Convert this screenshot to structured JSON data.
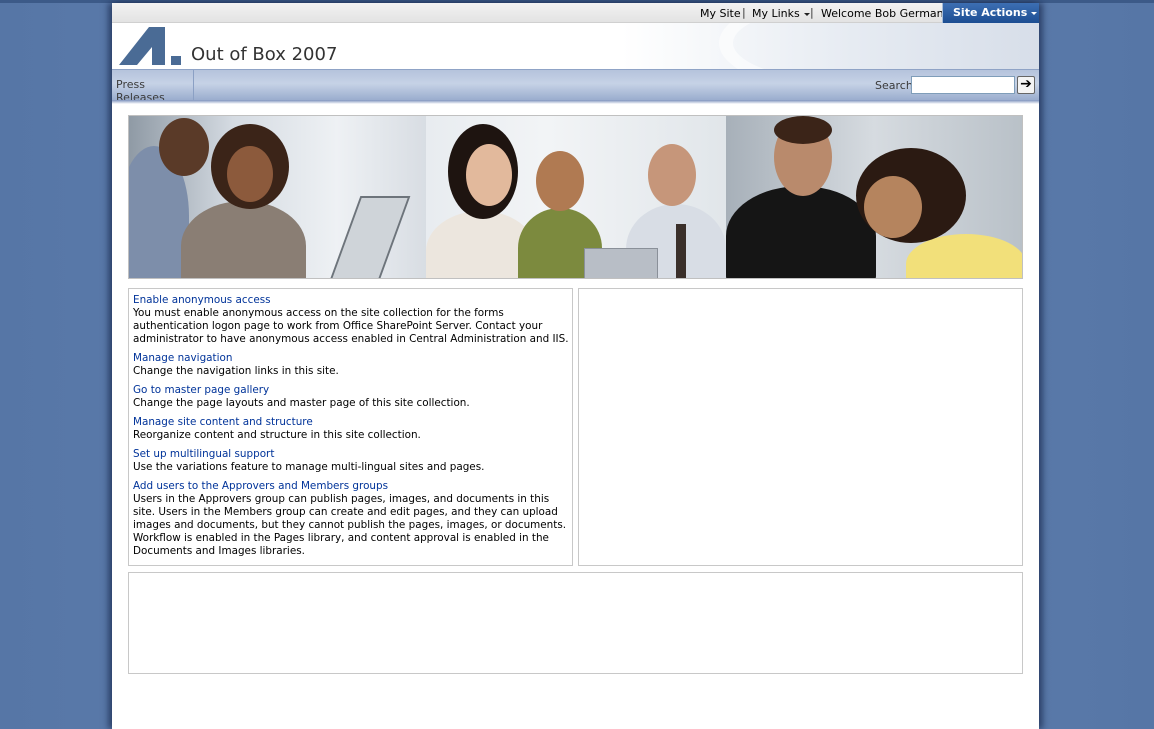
{
  "global_nav": {
    "my_site": "My Site",
    "separator": "|",
    "my_links": "My Links",
    "welcome": "Welcome Bob German",
    "site_actions": "Site Actions"
  },
  "header": {
    "site_title": "Out of Box 2007"
  },
  "top_nav": {
    "items": [
      {
        "label": "Press Releases"
      }
    ],
    "search_label": "Search",
    "search_value": "",
    "search_go_icon": "arrow-right-icon"
  },
  "tasks": [
    {
      "title": "Enable anonymous access",
      "description": "You must enable anonymous access on the site collection for the forms authentication logon page to work from Office SharePoint Server. Contact your administrator to have anonymous access enabled in Central Administration and IIS."
    },
    {
      "title": "Manage navigation",
      "description": "Change the navigation links in this site."
    },
    {
      "title": "Go to master page gallery",
      "description": "Change the page layouts and master page of this site collection."
    },
    {
      "title": "Manage site content and structure",
      "description": "Reorganize content and structure in this site collection."
    },
    {
      "title": "Set up multilingual support",
      "description": "Use the variations feature to manage multi-lingual sites and pages."
    },
    {
      "title": "Add users to the Approvers and Members groups",
      "description": "Users in the Approvers group can publish pages, images, and documents in this site. Users in the Members group can create and edit pages, and they can upload images and documents, but they cannot publish the pages, images, or documents. Workflow is enabled in the Pages library, and content approval is enabled in the Documents and Images libraries."
    }
  ],
  "colors": {
    "background": "#5a79a8",
    "link": "#003399",
    "site_actions": "#1c4d92"
  }
}
